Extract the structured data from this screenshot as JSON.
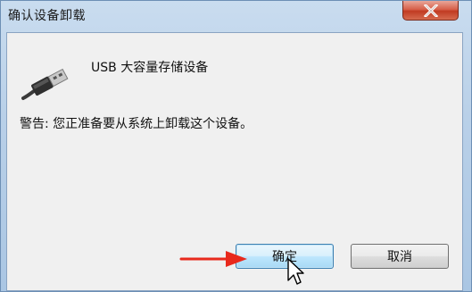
{
  "dialog": {
    "title": "确认设备卸载",
    "device_name": "USB 大容量存储设备",
    "warning": "警告: 您正准备要从系统上卸载这个设备。",
    "ok_label": "确定",
    "cancel_label": "取消"
  },
  "icons": {
    "close": "close-icon",
    "device": "usb-plug-icon",
    "annotation": "red-arrow-icon",
    "cursor": "mouse-cursor-icon"
  },
  "colors": {
    "close_button": "#c13b22",
    "ok_button_border": "#3c7fb1",
    "annotation_arrow": "#e8291c"
  }
}
